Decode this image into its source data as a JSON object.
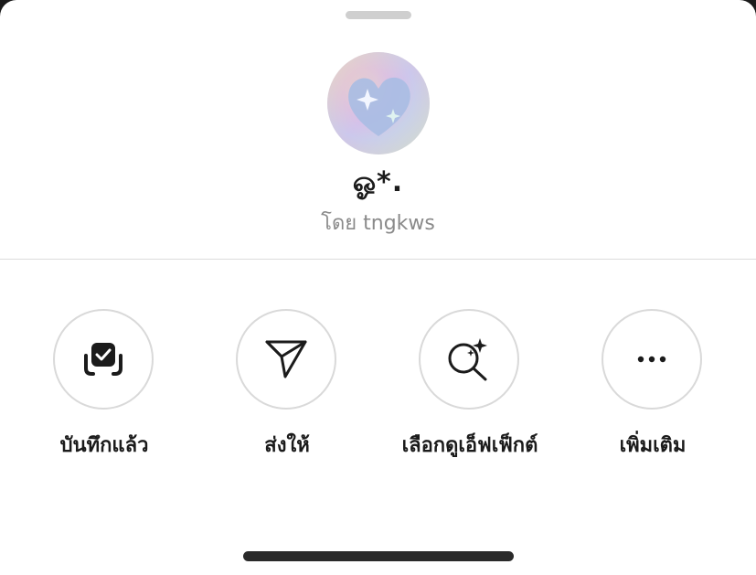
{
  "effect": {
    "name": "ஓ*.",
    "byline": "โดย tngkws"
  },
  "actions": [
    {
      "label": "บันทึกแล้ว",
      "icon": "saved-check-icon"
    },
    {
      "label": "ส่งให้",
      "icon": "send-icon"
    },
    {
      "label": "เลือกดูเอ็ฟเฟ็กต์",
      "icon": "browse-effects-icon"
    },
    {
      "label": "เพิ่มเติม",
      "icon": "more-icon"
    }
  ],
  "colors": {
    "background": "#ffffff",
    "text": "#1b1b1b",
    "secondary_text": "#8a8a8a",
    "circle_border": "#d9d9d9",
    "divider": "#dcdcdc",
    "home_indicator": "#2a2a2a"
  }
}
